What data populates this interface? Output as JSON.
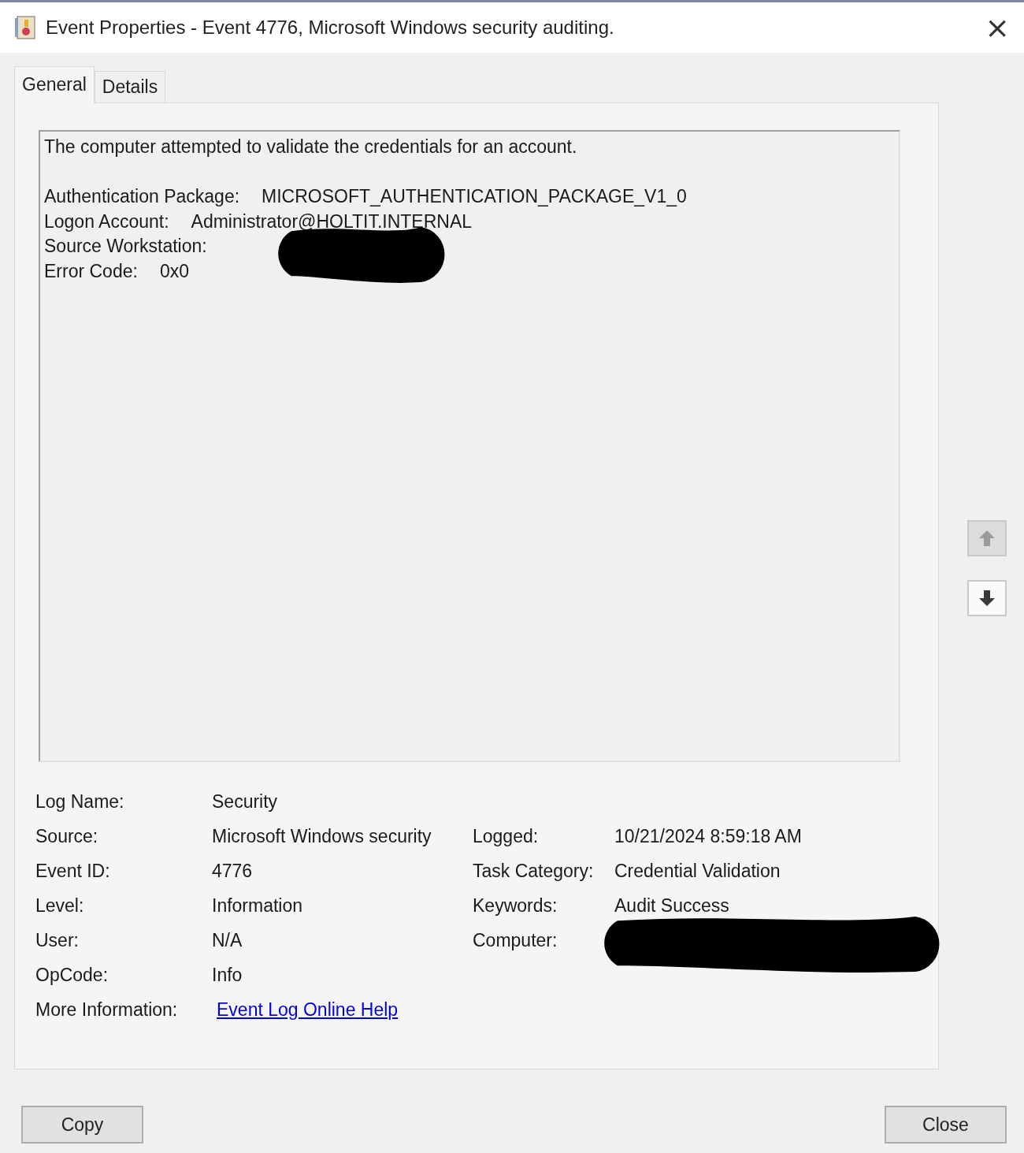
{
  "window": {
    "title": "Event Properties - Event 4776, Microsoft Windows security auditing.",
    "close": "×"
  },
  "tabs": [
    {
      "label": "General",
      "selected": true
    },
    {
      "label": "Details",
      "selected": false
    }
  ],
  "message": {
    "summary": "The computer attempted to validate the credentials for an account.",
    "fields": [
      {
        "label": "Authentication Package:",
        "value": "MICROSOFT_AUTHENTICATION_PACKAGE_V1_0",
        "redacted": false
      },
      {
        "label": "Logon Account:",
        "value": "Administrator@HOLTIT.INTERNAL",
        "redacted": false
      },
      {
        "label": "Source Workstation:",
        "redacted": true
      },
      {
        "label": "Error Code:",
        "value": "0x0",
        "redacted": false
      }
    ]
  },
  "nav_buttons": [
    {
      "kind": "up",
      "disabled": true
    },
    {
      "kind": "down",
      "disabled": false
    }
  ],
  "details": [
    {
      "label": "Log Name:",
      "value": "Security"
    },
    {
      "label": "Source:",
      "value": "Microsoft Windows security",
      "label_2": "Logged:",
      "value_2": "10/21/2024 8:59:18 AM"
    },
    {
      "label": "Event ID:",
      "value": "4776",
      "label_2": "Task Category:",
      "value_2": "Credential Validation"
    },
    {
      "label": "Level:",
      "value": "Information",
      "label_2": "Keywords:",
      "value_2": "Audit Success"
    },
    {
      "label": "User:",
      "value": "N/A",
      "label_2": "Computer:",
      "redacted_2": true
    },
    {
      "label": "OpCode:",
      "value": "Info"
    },
    {
      "label": "More Information:",
      "link": "Event Log Online Help"
    }
  ],
  "buttons": [
    "Copy",
    "Close"
  ]
}
